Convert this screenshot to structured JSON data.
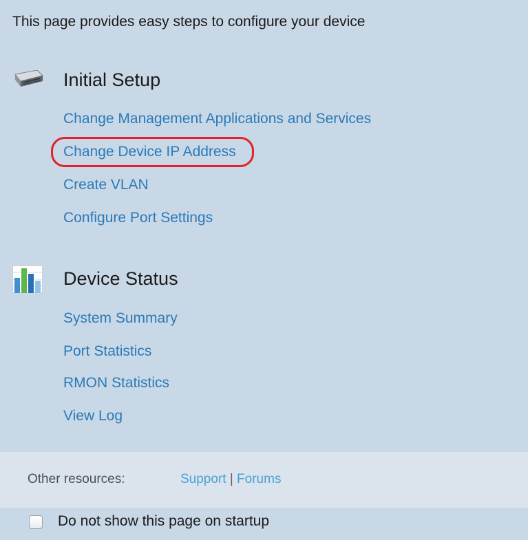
{
  "intro_text": "This page provides easy steps to configure your device",
  "initial_setup": {
    "title": "Initial Setup",
    "links": [
      "Change Management Applications and Services",
      "Change Device IP Address",
      "Create VLAN",
      "Configure Port Settings"
    ]
  },
  "device_status": {
    "title": "Device Status",
    "links": [
      "System Summary",
      "Port Statistics",
      "RMON Statistics",
      "View Log"
    ]
  },
  "resources": {
    "label": "Other resources:",
    "support": "Support",
    "separator": "|",
    "forums": "Forums"
  },
  "footer": {
    "checkbox_label": "Do not show this page on startup"
  },
  "colors": {
    "background": "#c9d8e6",
    "link": "#2a7ab8",
    "highlight": "#e0222a"
  }
}
